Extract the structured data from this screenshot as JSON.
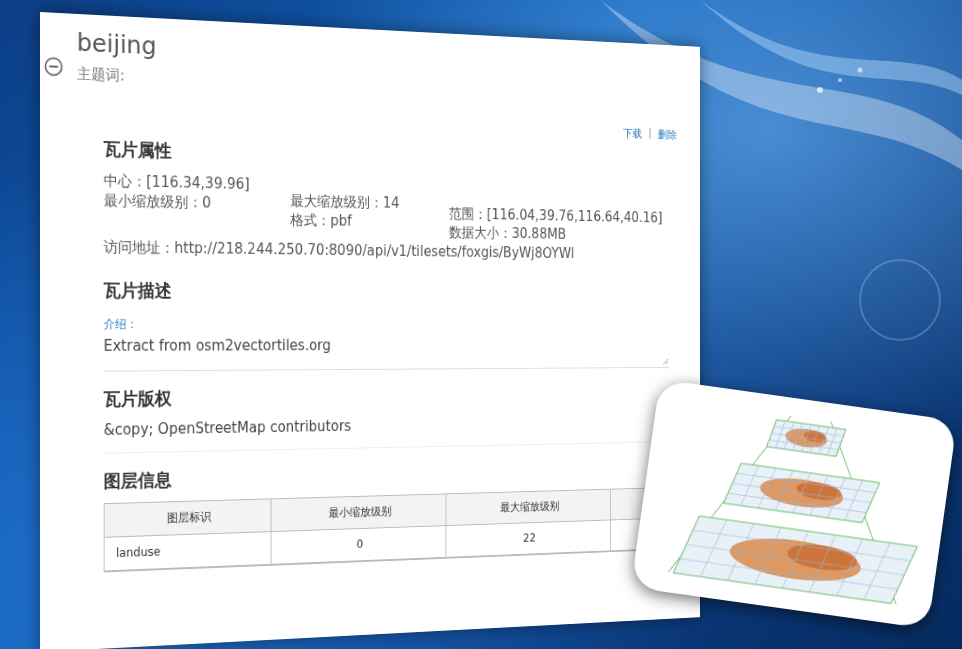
{
  "page": {
    "title": "beijing",
    "keywords_label": "主题词:"
  },
  "actions": {
    "items": [
      "下载",
      "删除"
    ],
    "separator": "|"
  },
  "tile_properties": {
    "heading": "瓦片属性",
    "columns": [
      [
        "中心：[116.34,39.96]",
        "最小缩放级别：0"
      ],
      [
        "最大缩放级别：14",
        "格式：pbf"
      ],
      [
        "范围：[116.04,39.76,116.64,40.16]",
        "数据大小：30.88MB"
      ]
    ],
    "url": "访问地址：http://218.244.250.70:8090/api/v1/tilesets/foxgis/ByWj8OYWl"
  },
  "tile_description": {
    "heading": "瓦片描述",
    "label": "介绍：",
    "text": "Extract from osm2vectortiles.org"
  },
  "tile_copyright": {
    "heading": "瓦片版权",
    "text": "&copy; OpenStreetMap contributors"
  },
  "layers": {
    "heading": "图层信息",
    "columns": [
      "图层标识",
      "最小缩放级别",
      "最大缩放级别"
    ],
    "rows": [
      [
        "landuse",
        "0",
        "22"
      ]
    ]
  }
}
